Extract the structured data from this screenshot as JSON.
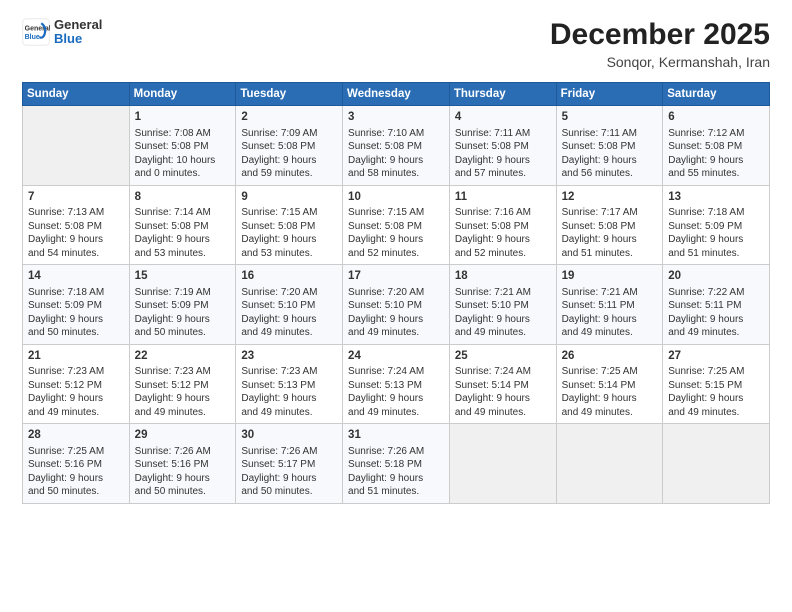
{
  "logo": {
    "general": "General",
    "blue": "Blue"
  },
  "title": {
    "month_year": "December 2025",
    "location": "Sonqor, Kermanshah, Iran"
  },
  "weekdays": [
    "Sunday",
    "Monday",
    "Tuesday",
    "Wednesday",
    "Thursday",
    "Friday",
    "Saturday"
  ],
  "weeks": [
    [
      {
        "day": "",
        "info": ""
      },
      {
        "day": "1",
        "info": "Sunrise: 7:08 AM\nSunset: 5:08 PM\nDaylight: 10 hours\nand 0 minutes."
      },
      {
        "day": "2",
        "info": "Sunrise: 7:09 AM\nSunset: 5:08 PM\nDaylight: 9 hours\nand 59 minutes."
      },
      {
        "day": "3",
        "info": "Sunrise: 7:10 AM\nSunset: 5:08 PM\nDaylight: 9 hours\nand 58 minutes."
      },
      {
        "day": "4",
        "info": "Sunrise: 7:11 AM\nSunset: 5:08 PM\nDaylight: 9 hours\nand 57 minutes."
      },
      {
        "day": "5",
        "info": "Sunrise: 7:11 AM\nSunset: 5:08 PM\nDaylight: 9 hours\nand 56 minutes."
      },
      {
        "day": "6",
        "info": "Sunrise: 7:12 AM\nSunset: 5:08 PM\nDaylight: 9 hours\nand 55 minutes."
      }
    ],
    [
      {
        "day": "7",
        "info": "Sunrise: 7:13 AM\nSunset: 5:08 PM\nDaylight: 9 hours\nand 54 minutes."
      },
      {
        "day": "8",
        "info": "Sunrise: 7:14 AM\nSunset: 5:08 PM\nDaylight: 9 hours\nand 53 minutes."
      },
      {
        "day": "9",
        "info": "Sunrise: 7:15 AM\nSunset: 5:08 PM\nDaylight: 9 hours\nand 53 minutes."
      },
      {
        "day": "10",
        "info": "Sunrise: 7:15 AM\nSunset: 5:08 PM\nDaylight: 9 hours\nand 52 minutes."
      },
      {
        "day": "11",
        "info": "Sunrise: 7:16 AM\nSunset: 5:08 PM\nDaylight: 9 hours\nand 52 minutes."
      },
      {
        "day": "12",
        "info": "Sunrise: 7:17 AM\nSunset: 5:08 PM\nDaylight: 9 hours\nand 51 minutes."
      },
      {
        "day": "13",
        "info": "Sunrise: 7:18 AM\nSunset: 5:09 PM\nDaylight: 9 hours\nand 51 minutes."
      }
    ],
    [
      {
        "day": "14",
        "info": "Sunrise: 7:18 AM\nSunset: 5:09 PM\nDaylight: 9 hours\nand 50 minutes."
      },
      {
        "day": "15",
        "info": "Sunrise: 7:19 AM\nSunset: 5:09 PM\nDaylight: 9 hours\nand 50 minutes."
      },
      {
        "day": "16",
        "info": "Sunrise: 7:20 AM\nSunset: 5:10 PM\nDaylight: 9 hours\nand 49 minutes."
      },
      {
        "day": "17",
        "info": "Sunrise: 7:20 AM\nSunset: 5:10 PM\nDaylight: 9 hours\nand 49 minutes."
      },
      {
        "day": "18",
        "info": "Sunrise: 7:21 AM\nSunset: 5:10 PM\nDaylight: 9 hours\nand 49 minutes."
      },
      {
        "day": "19",
        "info": "Sunrise: 7:21 AM\nSunset: 5:11 PM\nDaylight: 9 hours\nand 49 minutes."
      },
      {
        "day": "20",
        "info": "Sunrise: 7:22 AM\nSunset: 5:11 PM\nDaylight: 9 hours\nand 49 minutes."
      }
    ],
    [
      {
        "day": "21",
        "info": "Sunrise: 7:23 AM\nSunset: 5:12 PM\nDaylight: 9 hours\nand 49 minutes."
      },
      {
        "day": "22",
        "info": "Sunrise: 7:23 AM\nSunset: 5:12 PM\nDaylight: 9 hours\nand 49 minutes."
      },
      {
        "day": "23",
        "info": "Sunrise: 7:23 AM\nSunset: 5:13 PM\nDaylight: 9 hours\nand 49 minutes."
      },
      {
        "day": "24",
        "info": "Sunrise: 7:24 AM\nSunset: 5:13 PM\nDaylight: 9 hours\nand 49 minutes."
      },
      {
        "day": "25",
        "info": "Sunrise: 7:24 AM\nSunset: 5:14 PM\nDaylight: 9 hours\nand 49 minutes."
      },
      {
        "day": "26",
        "info": "Sunrise: 7:25 AM\nSunset: 5:14 PM\nDaylight: 9 hours\nand 49 minutes."
      },
      {
        "day": "27",
        "info": "Sunrise: 7:25 AM\nSunset: 5:15 PM\nDaylight: 9 hours\nand 49 minutes."
      }
    ],
    [
      {
        "day": "28",
        "info": "Sunrise: 7:25 AM\nSunset: 5:16 PM\nDaylight: 9 hours\nand 50 minutes."
      },
      {
        "day": "29",
        "info": "Sunrise: 7:26 AM\nSunset: 5:16 PM\nDaylight: 9 hours\nand 50 minutes."
      },
      {
        "day": "30",
        "info": "Sunrise: 7:26 AM\nSunset: 5:17 PM\nDaylight: 9 hours\nand 50 minutes."
      },
      {
        "day": "31",
        "info": "Sunrise: 7:26 AM\nSunset: 5:18 PM\nDaylight: 9 hours\nand 51 minutes."
      },
      {
        "day": "",
        "info": ""
      },
      {
        "day": "",
        "info": ""
      },
      {
        "day": "",
        "info": ""
      }
    ]
  ]
}
